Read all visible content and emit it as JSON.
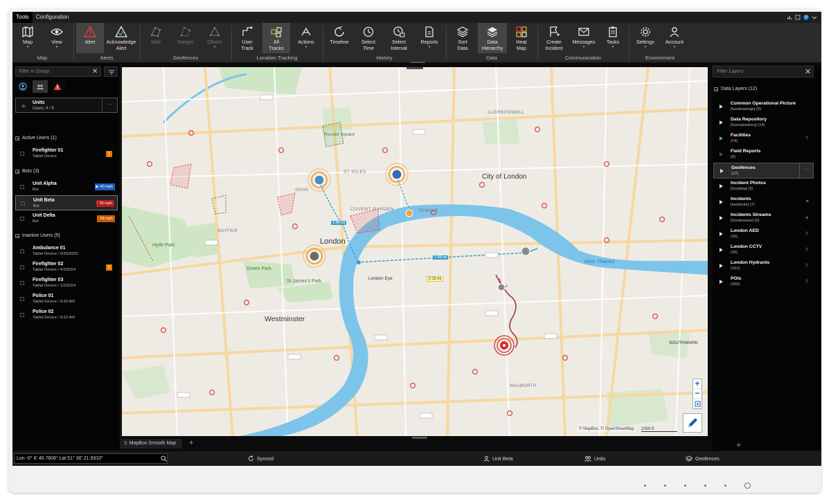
{
  "menubar": {
    "tabs": [
      "Tools",
      "Configuration"
    ]
  },
  "ribbon": {
    "buttons": {
      "map": "Map",
      "view": "View",
      "alert": "Alert",
      "acknowledge_1": "Acknowledge",
      "acknowledge_2": "Alert",
      "safe": "Safe",
      "danger": "Danger",
      "others": "Others",
      "user_track_1": "User",
      "user_track_2": "Track",
      "all_tracks_1": "All",
      "all_tracks_2": "Tracks",
      "actions": "Actions",
      "timeline": "Timeline",
      "select_time_1": "Select",
      "select_time_2": "Time",
      "select_interval_1": "Select",
      "select_interval_2": "Interval",
      "reports": "Reports",
      "sort_data_1": "Sort",
      "sort_data_2": "Data",
      "data_hierarchy_1": "Data",
      "data_hierarchy_2": "Hierarchy",
      "heat_map_1": "Heat",
      "heat_map_2": "Map",
      "create_incident_1": "Create",
      "create_incident_2": "Incident",
      "messages": "Messages",
      "tasks": "Tasks",
      "settings": "Settings",
      "account": "Account"
    },
    "groups": {
      "map": "Map",
      "alerts": "Alerts",
      "geofences": "Geofences",
      "location_tracking": "Location Tracking",
      "history": "History",
      "data": "Data",
      "communication": "Communication",
      "environment": "Environment"
    }
  },
  "left_panel": {
    "search_placeholder": "Filter in Group",
    "units_title": "Units",
    "units_count": "Users: 4 / 9",
    "sections": {
      "active": "Active Users (1)",
      "bots": "Bots (3)",
      "inactive": "Inactive Users (5)"
    },
    "active_users": [
      {
        "name": "Firefighter 01",
        "sub": "Tablet Device"
      }
    ],
    "bots": [
      {
        "name": "Unit Alpha",
        "sub": "Bot",
        "speed": "40 mph"
      },
      {
        "name": "Unit Beta",
        "sub": "Bot",
        "speed": "36 mph"
      },
      {
        "name": "Unit Delta",
        "sub": "Bot",
        "speed": "56 mph"
      }
    ],
    "inactive_users": [
      {
        "name": "Ambulance 01",
        "sub": "Tablet Device / 5/30/2023"
      },
      {
        "name": "Firefighter 02",
        "sub": "Tablet Device / 4/2/2024"
      },
      {
        "name": "Firefighter 03",
        "sub": "Tablet Device / 1/2/2024"
      },
      {
        "name": "Police 01",
        "sub": "Tablet Device / 9:20 AM"
      },
      {
        "name": "Police 02",
        "sub": "Tablet Device / 9:22 AM"
      }
    ]
  },
  "map": {
    "tab_label": "1: MapBox Smooth Map",
    "labels": {
      "london": "London",
      "city": "City of London",
      "westminster": "Westminster",
      "st_giles": "ST GILES",
      "covent_garden": "COVENT GARDEN",
      "clerkenwell": "CLERKENWELL",
      "temple": "TEMPLE",
      "hyde_park": "Hyde Park",
      "green_park": "Green Park",
      "st_james": "St James's Park",
      "russell_square": "Russell Square",
      "river_thames": "River Thames",
      "london_eye": "London Eye",
      "mayfair": "MAYFAIR",
      "soho": "SOHO",
      "walworth": "WALWORTH",
      "southwark": "SOUTHWARK"
    },
    "distance_1": "1.48 mi",
    "distance_2": "2.13 mi",
    "distance_3": "1.48 mi",
    "attribution": "© MapBox, © OpenStreetMap",
    "scale": "1000 ft"
  },
  "right_panel": {
    "search_placeholder": "Filter Layers",
    "header": "Data Layers (12)",
    "layers": [
      {
        "name": "Common Operational Picture",
        "sub": "[hzsdrawings] (0)"
      },
      {
        "name": "Data Repository",
        "sub": "[hzsrepository] (14)"
      },
      {
        "name": "Facilities",
        "sub": "(14)"
      },
      {
        "name": "Field Reports",
        "sub": "(0)"
      },
      {
        "name": "Geofences",
        "sub": "(10)"
      },
      {
        "name": "Incident Photos",
        "sub": "[hzsdata] (3)"
      },
      {
        "name": "Incidents",
        "sub": "[incidents] (7)"
      },
      {
        "name": "Incidents Streams",
        "sub": "[hzsstreams] (0)"
      },
      {
        "name": "London AED",
        "sub": "(25)"
      },
      {
        "name": "London CCTV",
        "sub": "(25)"
      },
      {
        "name": "London Hydrants",
        "sub": "(161)"
      },
      {
        "name": "POIs",
        "sub": "(356)"
      }
    ]
  },
  "status": {
    "coords": "Lon -0° 6' 40.7606\" Lat 51° 30' 21.9310\"",
    "synced": "Synced",
    "unit": "Unit Beta",
    "units": "Units",
    "geofences": "Geofences"
  },
  "colors": {
    "accent_blue": "#1e5fbf",
    "alert_red": "#e53935",
    "warn_orange": "#e07b00",
    "river": "#7cc4ea"
  }
}
